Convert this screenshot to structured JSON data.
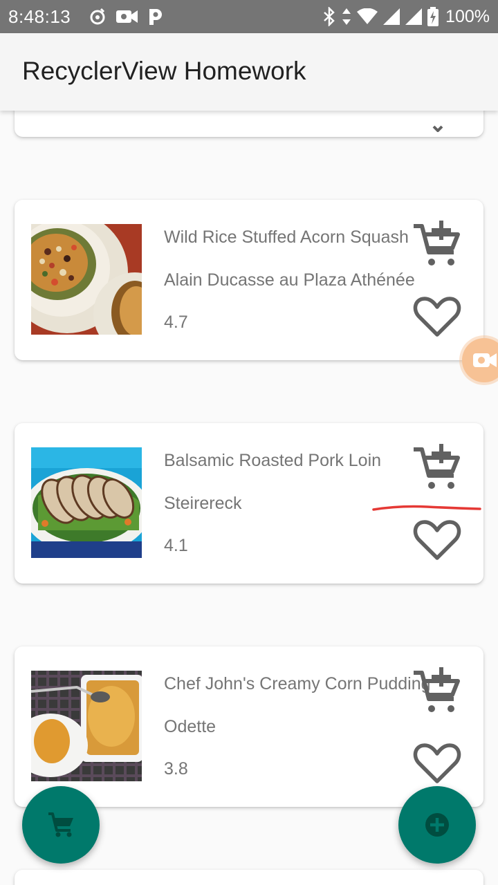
{
  "status_bar": {
    "time": "8:48:13",
    "battery": "100%",
    "left_icons": [
      "music-note-icon",
      "video-camera-icon",
      "p-app-icon"
    ],
    "right_icons": [
      "bluetooth-icon",
      "data-arrows-icon",
      "wifi-icon",
      "cell-signal-icon",
      "cell-signal-icon",
      "battery-charging-icon"
    ]
  },
  "app_bar": {
    "title": "RecyclerView Homework"
  },
  "items": [
    {
      "name": "Wild Rice Stuffed Acorn Squash",
      "restaurant": "Alain Ducasse au Plaza Athénée",
      "rating": "4.7",
      "add_icon": "add-shopping-cart-icon",
      "fav_icon": "heart-outline-icon"
    },
    {
      "name": "Balsamic Roasted Pork Loin",
      "restaurant": "Steirereck",
      "rating": "4.1",
      "add_icon": "add-shopping-cart-icon",
      "fav_icon": "heart-outline-icon"
    },
    {
      "name": "Chef John's Creamy Corn Pudding",
      "restaurant": "Odette",
      "rating": "3.8",
      "add_icon": "add-shopping-cart-icon",
      "fav_icon": "heart-outline-icon"
    }
  ],
  "fabs": {
    "cart": {
      "icon": "shopping-cart-icon"
    },
    "add": {
      "icon": "add-circle-icon"
    }
  },
  "colors": {
    "status_bar": "#757575",
    "app_bar": "#f5f5f5",
    "fab": "#00796b",
    "fab_icon": "#004d40",
    "text_secondary": "#757575",
    "icon_grey": "#616161",
    "annotation_red": "#e53935",
    "bubble": "#f7c295"
  }
}
